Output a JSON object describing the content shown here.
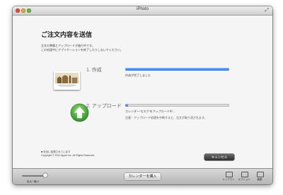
{
  "window": {
    "title": "iPhoto"
  },
  "heading": "ご注文内容を送信",
  "intro": {
    "line1": "注文の準備とアップロードが進行中です。",
    "line2": "この処理中にアプリケーションを終了したりしないでください。"
  },
  "step1": {
    "label": "1. 作成",
    "status": "作成が完了しました",
    "progress": 1.0
  },
  "step2": {
    "label": "2. アップロード",
    "status": "カレンダー“モスク”をアップロード中...",
    "note": "注意：アップロード処理を中断すると、注文が取り消されます。",
    "progress": 0.02
  },
  "footer": {
    "line1": "■ 安全に処理されています",
    "line2": "Copyright © 2012 Apple Inc. All Rights Reserved."
  },
  "buttons": {
    "cancel": "キャンセル",
    "buy": "カレンダーを購入"
  },
  "toolbar": {
    "zoom_label": "拡大 / 縮小",
    "layout": "レイアウト",
    "options": "オプション",
    "edit": "編集"
  },
  "colors": {
    "progress": "#2a6fe0",
    "upload_icon": "#3aa035"
  }
}
